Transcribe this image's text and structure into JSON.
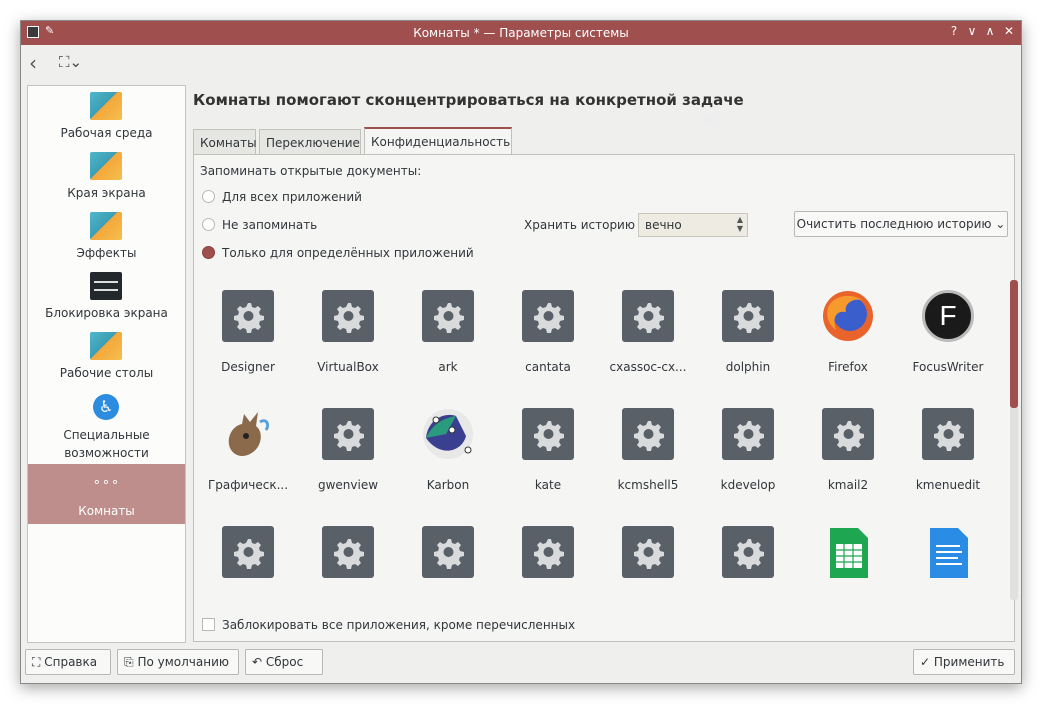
{
  "window": {
    "title": "Комнаты * — Параметры системы",
    "buttons": {
      "help": "?",
      "minimize": "∨",
      "maximize": "∧",
      "close": "✕"
    },
    "pin": "✎"
  },
  "toolbar": {
    "back": "‹",
    "rooms_menu": "⛶⌄"
  },
  "sidebar": {
    "items": [
      {
        "label": "Рабочая среда",
        "icon": "workspace-icon"
      },
      {
        "label": "Края экрана",
        "icon": "screen-edges-icon"
      },
      {
        "label": "Эффекты",
        "icon": "effects-icon"
      },
      {
        "label": "Блокировка экрана",
        "icon": "screen-lock-icon"
      },
      {
        "label": "Рабочие столы",
        "icon": "virtual-desktops-icon"
      },
      {
        "label": "Специальные возможности",
        "icon": "accessibility-icon",
        "glyph": "♿"
      },
      {
        "label": "Комнаты",
        "icon": "activities-icon",
        "glyph": "∘∘∘",
        "active": true
      }
    ]
  },
  "main": {
    "title": "Комнаты помогают сконцентрироваться на конкретной задаче",
    "tabs": [
      {
        "label": "Комнаты"
      },
      {
        "label": "Переключение"
      },
      {
        "label": "Конфиденциальность",
        "active": true
      }
    ],
    "privacy": {
      "remember_label": "Запоминать открытые документы:",
      "radio_all": "Для всех приложений",
      "radio_none": "Не запоминать",
      "radio_specific": "Только для определённых приложений",
      "selected": "specific",
      "history_label": "Хранить историю",
      "history_value": "вечно",
      "clear_button": "Очистить последнюю историю",
      "clear_arrow": "⌄",
      "block_all_label": "Заблокировать все приложения, кроме перечисленных",
      "block_all_checked": false
    },
    "apps": [
      {
        "name": "Designer",
        "icon": "gear-icon"
      },
      {
        "name": "VirtualBox",
        "icon": "gear-icon"
      },
      {
        "name": "ark",
        "icon": "gear-icon"
      },
      {
        "name": "cantata",
        "icon": "gear-icon"
      },
      {
        "name": "cxassoc-cx...",
        "icon": "gear-icon"
      },
      {
        "name": "dolphin",
        "icon": "gear-icon"
      },
      {
        "name": "Firefox",
        "icon": "firefox-icon"
      },
      {
        "name": "FocusWriter",
        "icon": "focuswriter-icon",
        "glyph": "F"
      },
      {
        "name": "Графическ...",
        "icon": "gimp-icon"
      },
      {
        "name": "gwenview",
        "icon": "gear-icon"
      },
      {
        "name": "Karbon",
        "icon": "karbon-icon"
      },
      {
        "name": "kate",
        "icon": "gear-icon"
      },
      {
        "name": "kcmshell5",
        "icon": "gear-icon"
      },
      {
        "name": "kdevelop",
        "icon": "gear-icon"
      },
      {
        "name": "kmail2",
        "icon": "gear-icon"
      },
      {
        "name": "kmenuedit",
        "icon": "gear-icon"
      },
      {
        "name": "",
        "icon": "gear-icon"
      },
      {
        "name": "",
        "icon": "gear-icon"
      },
      {
        "name": "",
        "icon": "gear-icon"
      },
      {
        "name": "",
        "icon": "gear-icon"
      },
      {
        "name": "",
        "icon": "gear-icon"
      },
      {
        "name": "",
        "icon": "gear-icon"
      },
      {
        "name": "",
        "icon": "libreoffice-calc-icon"
      },
      {
        "name": "",
        "icon": "libreoffice-writer-icon"
      }
    ]
  },
  "footer": {
    "help": "Справка",
    "defaults": "По умолчанию",
    "reset": "Сброс",
    "apply": "Применить",
    "help_glyph": "⛶",
    "defaults_glyph": "⎘",
    "reset_glyph": "↶",
    "apply_glyph": "✓"
  },
  "colors": {
    "accent": "#a04f4f",
    "selected_sidebar": "#bd8e8c",
    "gear_bg": "#596068"
  }
}
